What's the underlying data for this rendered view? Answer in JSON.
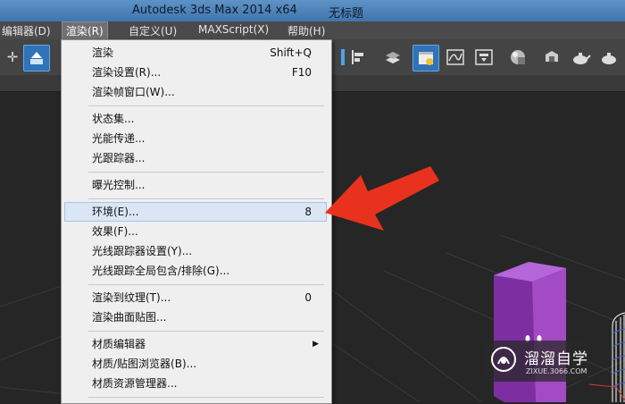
{
  "window": {
    "title": "Autodesk 3ds Max  2014 x64",
    "document": "无标题"
  },
  "menubar": [
    {
      "label": "编辑器(D)"
    },
    {
      "label": "渲染(R)",
      "active": true
    },
    {
      "label": "自定义(U)"
    },
    {
      "label": "MAXScript(X)"
    },
    {
      "label": "帮助(H)"
    }
  ],
  "render_menu": {
    "items": [
      {
        "label": "渲染",
        "shortcut": "Shift+Q"
      },
      {
        "label": "渲染设置(R)...",
        "shortcut": "F10"
      },
      {
        "label": "渲染帧窗口(W)..."
      },
      {
        "label": "状态集..."
      },
      {
        "label": "光能传递..."
      },
      {
        "label": "光跟踪器..."
      },
      {
        "label": "曝光控制..."
      },
      {
        "label": "环境(E)...",
        "shortcut": "8",
        "highlighted": true
      },
      {
        "label": "效果(F)..."
      },
      {
        "label": "光线跟踪器设置(Y)..."
      },
      {
        "label": "光线跟踪全局包含/排除(G)..."
      },
      {
        "label": "渲染到纹理(T)...",
        "shortcut": "0"
      },
      {
        "label": "渲染曲面贴图..."
      },
      {
        "label": "材质编辑器",
        "submenu": true
      },
      {
        "label": "材质/贴图浏览器(B)..."
      },
      {
        "label": "材质资源管理器..."
      }
    ]
  },
  "watermark": {
    "name": "溜溜自学",
    "url": "ZIXUE.3066.COM"
  },
  "colors": {
    "arrow": "#e8321e",
    "box": "#a34bc4",
    "highlight": "#dbe6f4",
    "menu_bg": "#efefef"
  }
}
